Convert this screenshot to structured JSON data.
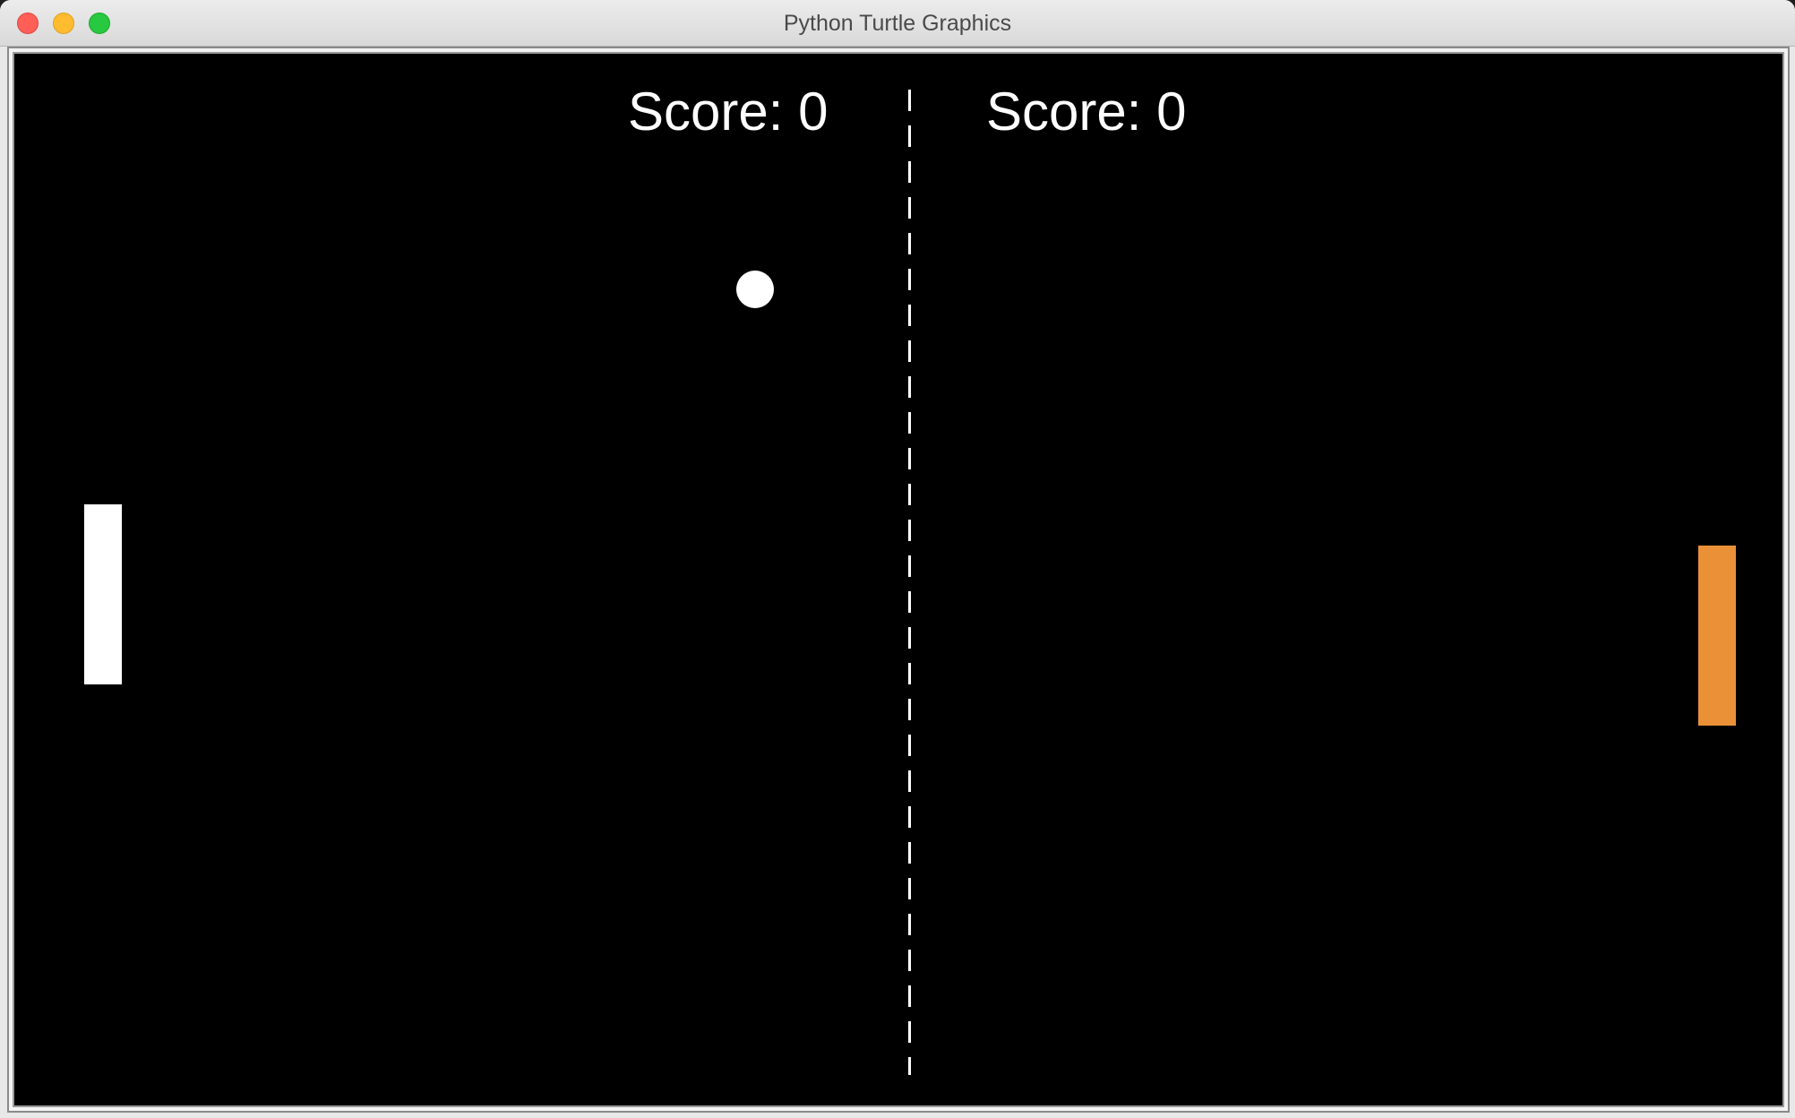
{
  "window": {
    "title": "Python Turtle Graphics"
  },
  "game": {
    "left_score_label": "Score: 0",
    "right_score_label": "Score: 0",
    "left_score": 0,
    "right_score": 0,
    "colors": {
      "background": "#000000",
      "left_paddle": "#ffffff",
      "right_paddle": "#ea9138",
      "ball": "#ffffff",
      "divider": "#ffffff",
      "score_text": "#ffffff"
    }
  }
}
